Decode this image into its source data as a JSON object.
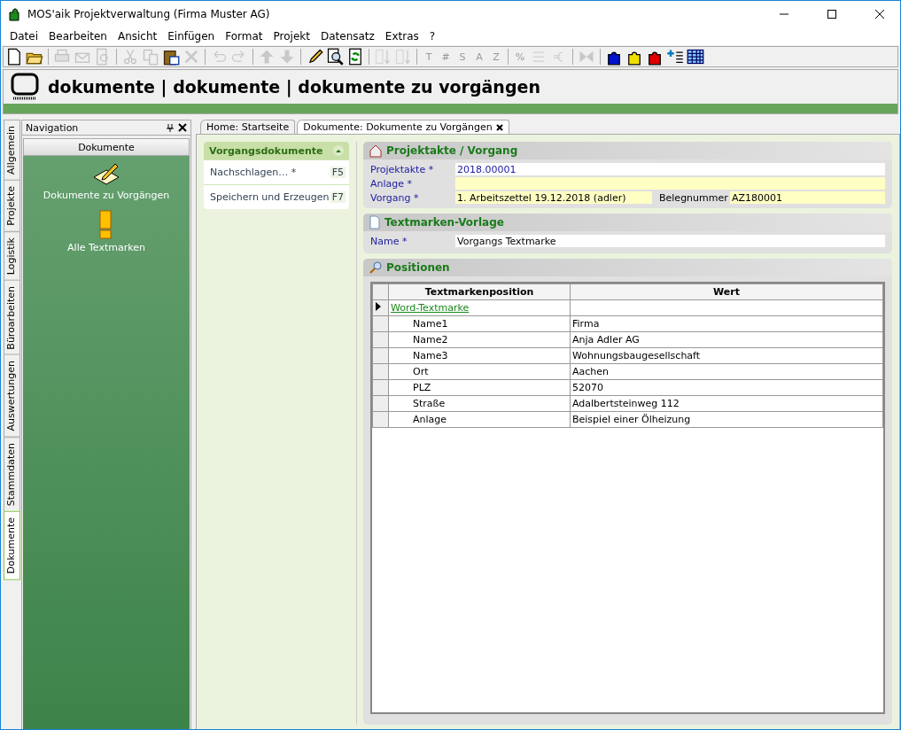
{
  "window": {
    "title": "MOS'aik Projektverwaltung (Firma Muster AG)"
  },
  "menu": [
    "Datei",
    "Bearbeiten",
    "Ansicht",
    "Einfügen",
    "Format",
    "Projekt",
    "Datensatz",
    "Extras",
    "?"
  ],
  "toolbar": [
    {
      "kind": "icon",
      "disabled": false
    },
    {
      "kind": "icon",
      "disabled": false
    },
    {
      "kind": "sep"
    },
    {
      "kind": "icon",
      "disabled": true
    },
    {
      "kind": "icon",
      "disabled": true
    },
    {
      "kind": "icon",
      "disabled": true
    },
    {
      "kind": "sep"
    },
    {
      "kind": "icon",
      "disabled": true
    },
    {
      "kind": "icon",
      "disabled": true
    },
    {
      "kind": "icon",
      "disabled": false
    },
    {
      "kind": "icon",
      "disabled": true
    },
    {
      "kind": "sep"
    },
    {
      "kind": "icon",
      "disabled": true
    },
    {
      "kind": "icon",
      "disabled": true
    },
    {
      "kind": "sep"
    },
    {
      "kind": "icon",
      "disabled": true
    },
    {
      "kind": "icon",
      "disabled": true
    },
    {
      "kind": "sep"
    },
    {
      "kind": "icon",
      "disabled": false
    },
    {
      "kind": "icon",
      "disabled": false
    },
    {
      "kind": "icon",
      "disabled": false
    },
    {
      "kind": "sep"
    },
    {
      "kind": "icon",
      "disabled": true
    },
    {
      "kind": "icon",
      "disabled": true
    },
    {
      "kind": "sep"
    },
    {
      "kind": "glyph",
      "text": "T",
      "disabled": true
    },
    {
      "kind": "glyph",
      "text": "#",
      "disabled": true
    },
    {
      "kind": "glyph",
      "text": "S",
      "disabled": true
    },
    {
      "kind": "glyph",
      "text": "A",
      "disabled": true
    },
    {
      "kind": "glyph",
      "text": "Z",
      "disabled": true
    },
    {
      "kind": "sep"
    },
    {
      "kind": "glyph",
      "text": "%",
      "disabled": true
    },
    {
      "kind": "icon",
      "disabled": true
    },
    {
      "kind": "icon",
      "disabled": true
    },
    {
      "kind": "sep"
    },
    {
      "kind": "icon",
      "disabled": true
    },
    {
      "kind": "sep"
    },
    {
      "kind": "icon",
      "disabled": false
    },
    {
      "kind": "icon",
      "disabled": false
    },
    {
      "kind": "icon",
      "disabled": false
    },
    {
      "kind": "icon",
      "disabled": false
    },
    {
      "kind": "icon",
      "disabled": false
    }
  ],
  "header": {
    "title": "dokumente | dokumente | dokumente zu vorgängen"
  },
  "side_tabs": [
    {
      "label": "Allgemein",
      "selected": false
    },
    {
      "label": "Projekte",
      "selected": false
    },
    {
      "label": "Logistik",
      "selected": false
    },
    {
      "label": "Büroarbeiten",
      "selected": false
    },
    {
      "label": "Auswertungen",
      "selected": false
    },
    {
      "label": "Stammdaten",
      "selected": false
    },
    {
      "label": "Dokumente",
      "selected": true
    }
  ],
  "navigation": {
    "title": "Navigation",
    "section": "Dokumente",
    "items": [
      {
        "label": "Dokumente zu Vorgängen",
        "kind": "pencil"
      },
      {
        "label": "Alle Textmarken",
        "kind": "marker"
      }
    ]
  },
  "doc_tabs": [
    {
      "label": "Home: Startseite",
      "selected": false,
      "closable": false
    },
    {
      "label": "Dokumente: Dokumente zu Vorgängen",
      "selected": true,
      "closable": true
    }
  ],
  "task_pane": {
    "title": "Vorgangsdokumente",
    "items": [
      {
        "label": "Nachschlagen… *",
        "key": "F5"
      },
      {
        "label": "Speichern und Erzeugen",
        "key": "F7"
      }
    ]
  },
  "project_section": {
    "title": "Projektakte / Vorgang",
    "fields": [
      {
        "label": "Projektakte *",
        "value": "2018.00001",
        "required": false
      },
      {
        "label": "Anlage *",
        "required": true
      }
    ],
    "vorgang": {
      "label": "Vorgang *",
      "value": "1. Arbeitszettel 19.12.2018 (adler)",
      "beleg_label": "Belegnummer",
      "beleg_value": "AZ180001"
    }
  },
  "template_section": {
    "title": "Textmarken-Vorlage",
    "name_label": "Name *",
    "name_value": "Vorgangs Textmarke"
  },
  "positions_section": {
    "title": "Positionen",
    "columns": [
      "Textmarkenposition",
      "Wert"
    ],
    "rows": [
      {
        "position": "Word-Textmarke",
        "current": true,
        "children": [
          {
            "position": "Name1",
            "value": "Firma"
          },
          {
            "position": "Name2",
            "value": "Anja Adler AG"
          },
          {
            "position": "Name3",
            "value": "Wohnungsbaugesellschaft"
          },
          {
            "position": "Ort",
            "value": "Aachen"
          },
          {
            "position": "PLZ",
            "value": "52070"
          },
          {
            "position": "Straße",
            "value": "Adalbertsteinweg 112"
          },
          {
            "position": "Anlage",
            "value": "Beispiel einer Ölheizung"
          }
        ]
      }
    ]
  }
}
